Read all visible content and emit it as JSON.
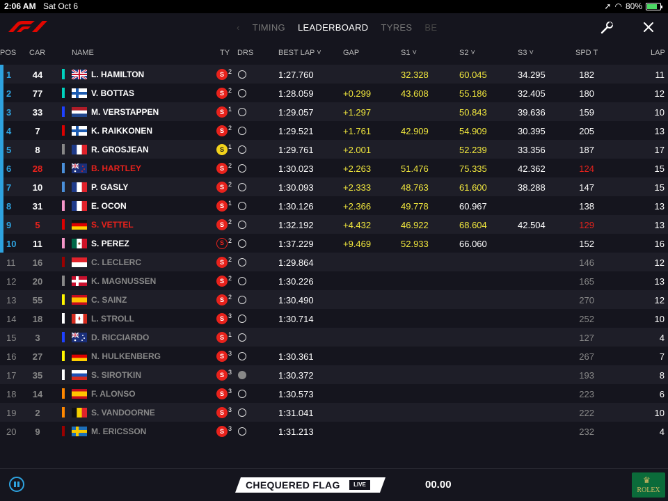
{
  "status_bar": {
    "time": "2:06 AM",
    "date": "Sat Oct 6",
    "battery": "80%"
  },
  "tabs": [
    {
      "label": "TIMING",
      "active": false
    },
    {
      "label": "LEADERBOARD",
      "active": true
    },
    {
      "label": "TYRES",
      "active": false
    },
    {
      "label": "BE",
      "active": false
    }
  ],
  "columns": {
    "pos": "POS",
    "car": "CAR",
    "name": "NAME",
    "ty": "TY",
    "drs": "DRS",
    "best_lap": "BEST LAP",
    "gap": "GAP",
    "s1": "S1",
    "s2": "S2",
    "s3": "S3",
    "spd": "SPD T",
    "lap": "LAP"
  },
  "colors": {
    "accent_blue": "#2ea3e0",
    "yellow": "#f2e83d",
    "red": "#e8221c",
    "bg": "#15151e"
  },
  "drivers": [
    {
      "pos": "1",
      "car": "44",
      "name": "L. HAMILTON",
      "team_color": "#00d2be",
      "flag": "gb",
      "tyre": "S",
      "tyre_style": "soft",
      "stint": "2",
      "drs": "open",
      "best": "1:27.760",
      "gap": "",
      "s1": "32.328",
      "s1c": "yellow",
      "s2": "60.045",
      "s2c": "yellow",
      "s3": "34.295",
      "s3c": "",
      "spd": "182",
      "spdc": "",
      "lap": "11",
      "dim": false,
      "name_red": false
    },
    {
      "pos": "2",
      "car": "77",
      "name": "V. BOTTAS",
      "team_color": "#00d2be",
      "flag": "fi",
      "tyre": "S",
      "tyre_style": "soft",
      "stint": "2",
      "drs": "open",
      "best": "1:28.059",
      "gap": "+0.299",
      "s1": "43.608",
      "s1c": "yellow",
      "s2": "55.186",
      "s2c": "yellow",
      "s3": "32.405",
      "s3c": "",
      "spd": "180",
      "spdc": "",
      "lap": "12",
      "dim": false,
      "name_red": false
    },
    {
      "pos": "3",
      "car": "33",
      "name": "M. VERSTAPPEN",
      "team_color": "#1e41ff",
      "flag": "nl",
      "tyre": "S",
      "tyre_style": "soft",
      "stint": "1",
      "drs": "open",
      "best": "1:29.057",
      "gap": "+1.297",
      "s1": "",
      "s1c": "",
      "s2": "50.843",
      "s2c": "yellow",
      "s3": "39.636",
      "s3c": "",
      "spd": "159",
      "spdc": "",
      "lap": "10",
      "dim": false,
      "name_red": false
    },
    {
      "pos": "4",
      "car": "7",
      "name": "K. RAIKKONEN",
      "team_color": "#dc0000",
      "flag": "fi",
      "tyre": "S",
      "tyre_style": "soft",
      "stint": "2",
      "drs": "open",
      "best": "1:29.521",
      "gap": "+1.761",
      "s1": "42.909",
      "s1c": "yellow",
      "s2": "54.909",
      "s2c": "yellow",
      "s3": "30.395",
      "s3c": "",
      "spd": "205",
      "spdc": "",
      "lap": "13",
      "dim": false,
      "name_red": false
    },
    {
      "pos": "5",
      "car": "8",
      "name": "R. GROSJEAN",
      "team_color": "#888888",
      "flag": "fr",
      "tyre": "S",
      "tyre_style": "ultra",
      "stint": "1",
      "drs": "open",
      "best": "1:29.761",
      "gap": "+2.001",
      "s1": "",
      "s1c": "",
      "s2": "52.239",
      "s2c": "yellow",
      "s3": "33.356",
      "s3c": "",
      "spd": "187",
      "spdc": "",
      "lap": "17",
      "dim": false,
      "name_red": false
    },
    {
      "pos": "6",
      "car": "28",
      "name": "B. HARTLEY",
      "team_color": "#4a8fd9",
      "flag": "nz",
      "tyre": "S",
      "tyre_style": "soft",
      "stint": "2",
      "drs": "open",
      "best": "1:30.023",
      "gap": "+2.263",
      "s1": "51.476",
      "s1c": "yellow",
      "s2": "75.335",
      "s2c": "yellow",
      "s3": "42.362",
      "s3c": "",
      "spd": "124",
      "spdc": "red",
      "lap": "15",
      "dim": false,
      "name_red": true
    },
    {
      "pos": "7",
      "car": "10",
      "name": "P. GASLY",
      "team_color": "#4a8fd9",
      "flag": "fr",
      "tyre": "S",
      "tyre_style": "soft",
      "stint": "2",
      "drs": "open",
      "best": "1:30.093",
      "gap": "+2.333",
      "s1": "48.763",
      "s1c": "yellow",
      "s2": "61.600",
      "s2c": "yellow",
      "s3": "38.288",
      "s3c": "",
      "spd": "147",
      "spdc": "",
      "lap": "15",
      "dim": false,
      "name_red": false
    },
    {
      "pos": "8",
      "car": "31",
      "name": "E. OCON",
      "team_color": "#f596c8",
      "flag": "fr",
      "tyre": "S",
      "tyre_style": "soft",
      "stint": "1",
      "drs": "open",
      "best": "1:30.126",
      "gap": "+2.366",
      "s1": "49.778",
      "s1c": "yellow",
      "s2": "60.967",
      "s2c": "",
      "s3": "",
      "s3c": "",
      "spd": "138",
      "spdc": "",
      "lap": "13",
      "dim": false,
      "name_red": false
    },
    {
      "pos": "9",
      "car": "5",
      "name": "S. VETTEL",
      "team_color": "#dc0000",
      "flag": "de",
      "tyre": "S",
      "tyre_style": "soft",
      "stint": "2",
      "drs": "open",
      "best": "1:32.192",
      "gap": "+4.432",
      "s1": "46.922",
      "s1c": "yellow",
      "s2": "68.604",
      "s2c": "yellow",
      "s3": "42.504",
      "s3c": "",
      "spd": "129",
      "spdc": "red",
      "lap": "13",
      "dim": false,
      "name_red": true
    },
    {
      "pos": "10",
      "car": "11",
      "name": "S. PEREZ",
      "team_color": "#f596c8",
      "flag": "mx",
      "tyre": "S",
      "tyre_style": "softring",
      "stint": "2",
      "drs": "open",
      "best": "1:37.229",
      "gap": "+9.469",
      "s1": "52.933",
      "s1c": "yellow",
      "s2": "66.060",
      "s2c": "",
      "s3": "",
      "s3c": "",
      "spd": "152",
      "spdc": "",
      "lap": "16",
      "dim": false,
      "name_red": false
    },
    {
      "pos": "11",
      "car": "16",
      "name": "C. LECLERC",
      "team_color": "#9b0000",
      "flag": "mc",
      "tyre": "S",
      "tyre_style": "soft",
      "stint": "2",
      "drs": "open",
      "best": "1:29.864",
      "gap": "",
      "s1": "",
      "s1c": "",
      "s2": "",
      "s2c": "",
      "s3": "",
      "s3c": "",
      "spd": "146",
      "spdc": "",
      "lap": "12",
      "dim": true,
      "name_red": false
    },
    {
      "pos": "12",
      "car": "20",
      "name": "K. MAGNUSSEN",
      "team_color": "#888888",
      "flag": "dk",
      "tyre": "S",
      "tyre_style": "soft",
      "stint": "2",
      "drs": "open",
      "best": "1:30.226",
      "gap": "",
      "s1": "",
      "s1c": "",
      "s2": "",
      "s2c": "",
      "s3": "",
      "s3c": "",
      "spd": "165",
      "spdc": "",
      "lap": "13",
      "dim": true,
      "name_red": false
    },
    {
      "pos": "13",
      "car": "55",
      "name": "C. SAINZ",
      "team_color": "#fff500",
      "flag": "es",
      "tyre": "S",
      "tyre_style": "soft",
      "stint": "2",
      "drs": "open",
      "best": "1:30.490",
      "gap": "",
      "s1": "",
      "s1c": "",
      "s2": "",
      "s2c": "",
      "s3": "",
      "s3c": "",
      "spd": "270",
      "spdc": "",
      "lap": "12",
      "dim": true,
      "name_red": false
    },
    {
      "pos": "14",
      "car": "18",
      "name": "L. STROLL",
      "team_color": "#ffffff",
      "flag": "ca",
      "tyre": "S",
      "tyre_style": "soft",
      "stint": "3",
      "drs": "open",
      "best": "1:30.714",
      "gap": "",
      "s1": "",
      "s1c": "",
      "s2": "",
      "s2c": "",
      "s3": "",
      "s3c": "",
      "spd": "252",
      "spdc": "",
      "lap": "10",
      "dim": true,
      "name_red": false
    },
    {
      "pos": "15",
      "car": "3",
      "name": "D. RICCIARDO",
      "team_color": "#1e41ff",
      "flag": "au",
      "tyre": "S",
      "tyre_style": "soft",
      "stint": "1",
      "drs": "open",
      "best": "",
      "gap": "",
      "s1": "",
      "s1c": "",
      "s2": "",
      "s2c": "",
      "s3": "",
      "s3c": "",
      "spd": "127",
      "spdc": "",
      "lap": "4",
      "dim": true,
      "name_red": false
    },
    {
      "pos": "16",
      "car": "27",
      "name": "N. HULKENBERG",
      "team_color": "#fff500",
      "flag": "de",
      "tyre": "S",
      "tyre_style": "soft",
      "stint": "3",
      "drs": "open",
      "best": "1:30.361",
      "gap": "",
      "s1": "",
      "s1c": "",
      "s2": "",
      "s2c": "",
      "s3": "",
      "s3c": "",
      "spd": "267",
      "spdc": "",
      "lap": "7",
      "dim": true,
      "name_red": false
    },
    {
      "pos": "17",
      "car": "35",
      "name": "S. SIROTKIN",
      "team_color": "#ffffff",
      "flag": "ru",
      "tyre": "S",
      "tyre_style": "soft",
      "stint": "3",
      "drs": "filled",
      "best": "1:30.372",
      "gap": "",
      "s1": "",
      "s1c": "",
      "s2": "",
      "s2c": "",
      "s3": "",
      "s3c": "",
      "spd": "193",
      "spdc": "",
      "lap": "8",
      "dim": true,
      "name_red": false
    },
    {
      "pos": "18",
      "car": "14",
      "name": "F. ALONSO",
      "team_color": "#ff8700",
      "flag": "es",
      "tyre": "S",
      "tyre_style": "soft",
      "stint": "3",
      "drs": "open",
      "best": "1:30.573",
      "gap": "",
      "s1": "",
      "s1c": "",
      "s2": "",
      "s2c": "",
      "s3": "",
      "s3c": "",
      "spd": "223",
      "spdc": "",
      "lap": "6",
      "dim": true,
      "name_red": false
    },
    {
      "pos": "19",
      "car": "2",
      "name": "S. VANDOORNE",
      "team_color": "#ff8700",
      "flag": "be",
      "tyre": "S",
      "tyre_style": "soft",
      "stint": "3",
      "drs": "open",
      "best": "1:31.041",
      "gap": "",
      "s1": "",
      "s1c": "",
      "s2": "",
      "s2c": "",
      "s3": "",
      "s3c": "",
      "spd": "222",
      "spdc": "",
      "lap": "10",
      "dim": true,
      "name_red": false
    },
    {
      "pos": "20",
      "car": "9",
      "name": "M. ERICSSON",
      "team_color": "#9b0000",
      "flag": "se",
      "tyre": "S",
      "tyre_style": "soft",
      "stint": "3",
      "drs": "open",
      "best": "1:31.213",
      "gap": "",
      "s1": "",
      "s1c": "",
      "s2": "",
      "s2c": "",
      "s3": "",
      "s3c": "",
      "spd": "232",
      "spdc": "",
      "lap": "4",
      "dim": true,
      "name_red": false
    }
  ],
  "footer": {
    "flag_text": "CHEQUERED FLAG",
    "live": "LIVE",
    "clock": "00.00",
    "sponsor": "ROLEX"
  }
}
